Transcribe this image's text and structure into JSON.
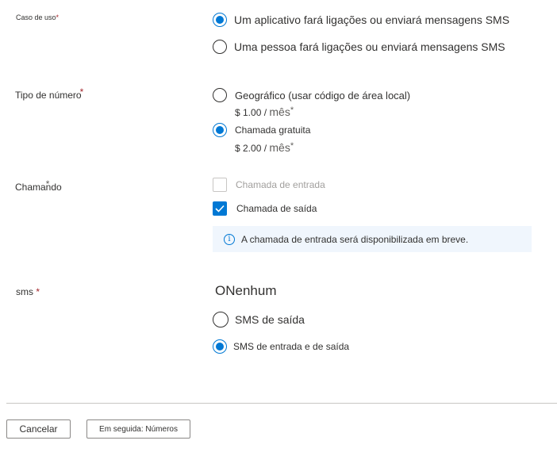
{
  "use_case": {
    "label": "Caso de uso",
    "required": "*",
    "options": [
      {
        "text": "Um aplicativo fará ligações ou enviará mensagens SMS",
        "selected": true
      },
      {
        "text": "Uma pessoa fará ligações ou enviará mensagens SMS",
        "selected": false
      }
    ]
  },
  "number_type": {
    "label": "Tipo de número",
    "required": "*",
    "options": [
      {
        "text": "Geográfico (usar código de área local)",
        "price": "$ 1.00 /",
        "unit": "mês",
        "unit_mark": "*",
        "selected": false
      },
      {
        "text": "Chamada gratuita",
        "price": "$ 2.00 /",
        "unit": "mês",
        "unit_mark": "*",
        "selected": true
      }
    ]
  },
  "calling": {
    "label": "Chamando",
    "required": "*",
    "options": [
      {
        "text": "Chamada de entrada",
        "checked": false,
        "disabled": true
      },
      {
        "text": "Chamada de saída",
        "checked": true,
        "disabled": false
      }
    ],
    "info": "A chamada de entrada será disponibilizada em breve."
  },
  "sms": {
    "label": "sms",
    "required": "*",
    "none_text": "ONenhum",
    "options": [
      {
        "text": "SMS de saída",
        "selected": false
      },
      {
        "text": "SMS de entrada e de saída",
        "selected": true
      }
    ]
  },
  "footer": {
    "cancel_label": "Cancelar",
    "next_label": "Em seguida: Números"
  },
  "colors": {
    "accent": "#0078d4",
    "required": "#a4262c",
    "info_background": "#f0f6fd"
  }
}
